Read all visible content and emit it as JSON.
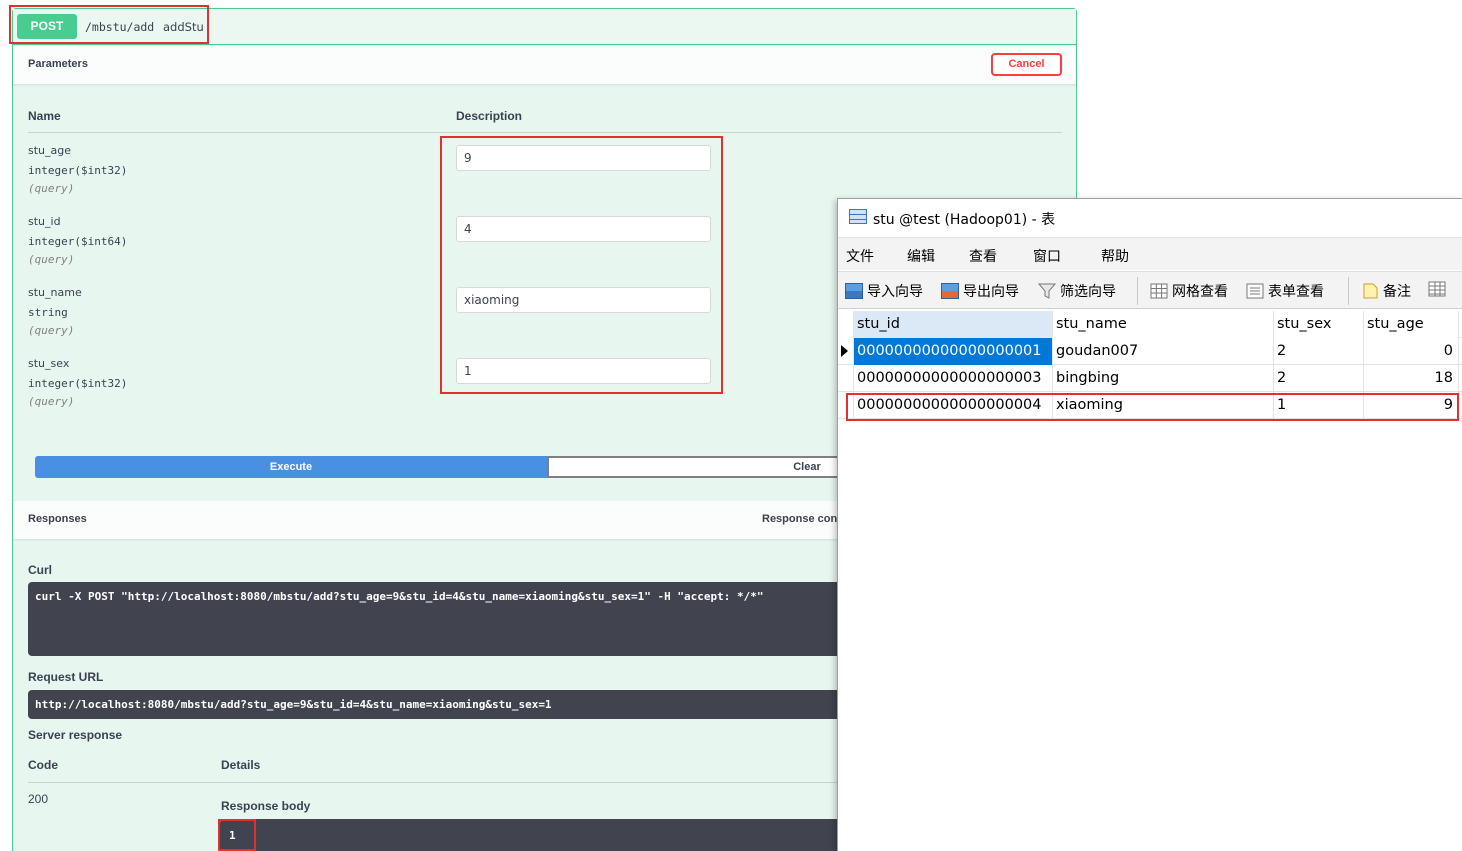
{
  "swagger": {
    "method": "POST",
    "path": "/mbstu/add",
    "summary": "addStu",
    "parameters_title": "Parameters",
    "cancel_label": "Cancel",
    "col_name": "Name",
    "col_description": "Description",
    "params": [
      {
        "name": "stu_age",
        "type": "integer($int32)",
        "in": "(query)",
        "value": "9"
      },
      {
        "name": "stu_id",
        "type": "integer($int64)",
        "in": "(query)",
        "value": "4"
      },
      {
        "name": "stu_name",
        "type": "string",
        "in": "(query)",
        "value": "xiaoming"
      },
      {
        "name": "stu_sex",
        "type": "integer($int32)",
        "in": "(query)",
        "value": "1"
      }
    ],
    "execute_label": "Execute",
    "clear_label": "Clear",
    "responses_title": "Responses",
    "response_content_label": "Response cont",
    "curl_label": "Curl",
    "curl_command": "curl -X POST \"http://localhost:8080/mbstu/add?stu_age=9&stu_id=4&stu_name=xiaoming&stu_sex=1\" -H \"accept: */*\"",
    "request_url_label": "Request URL",
    "request_url": "http://localhost:8080/mbstu/add?stu_age=9&stu_id=4&stu_name=xiaoming&stu_sex=1",
    "server_response_label": "Server response",
    "code_label": "Code",
    "details_label": "Details",
    "code_value": "200",
    "response_body_label": "Response body",
    "response_body": "1",
    "colors": {
      "accent": "#49cc90",
      "execute": "#4990e2",
      "cancel": "#f93e3e",
      "code_bg": "#41444e"
    }
  },
  "navicat": {
    "title": "stu @test (Hadoop01) - 表",
    "menu": [
      "文件",
      "编辑",
      "查看",
      "窗口",
      "帮助"
    ],
    "toolbar": [
      {
        "label": "导入向导",
        "icon": "import-icon"
      },
      {
        "label": "导出向导",
        "icon": "export-icon"
      },
      {
        "label": "筛选向导",
        "icon": "filter-icon"
      },
      {
        "label": "网格查看",
        "icon": "grid-view-icon"
      },
      {
        "label": "表单查看",
        "icon": "form-view-icon"
      },
      {
        "label": "备注",
        "icon": "note-icon"
      }
    ],
    "columns": [
      "stu_id",
      "stu_name",
      "stu_sex",
      "stu_age"
    ],
    "rows": [
      [
        "00000000000000000001",
        "goudan007",
        "2",
        "0"
      ],
      [
        "00000000000000000003",
        "bingbing",
        "2",
        "18"
      ],
      [
        "00000000000000000004",
        "xiaoming",
        "1",
        "9"
      ]
    ],
    "selection_color": "#0078d7"
  }
}
